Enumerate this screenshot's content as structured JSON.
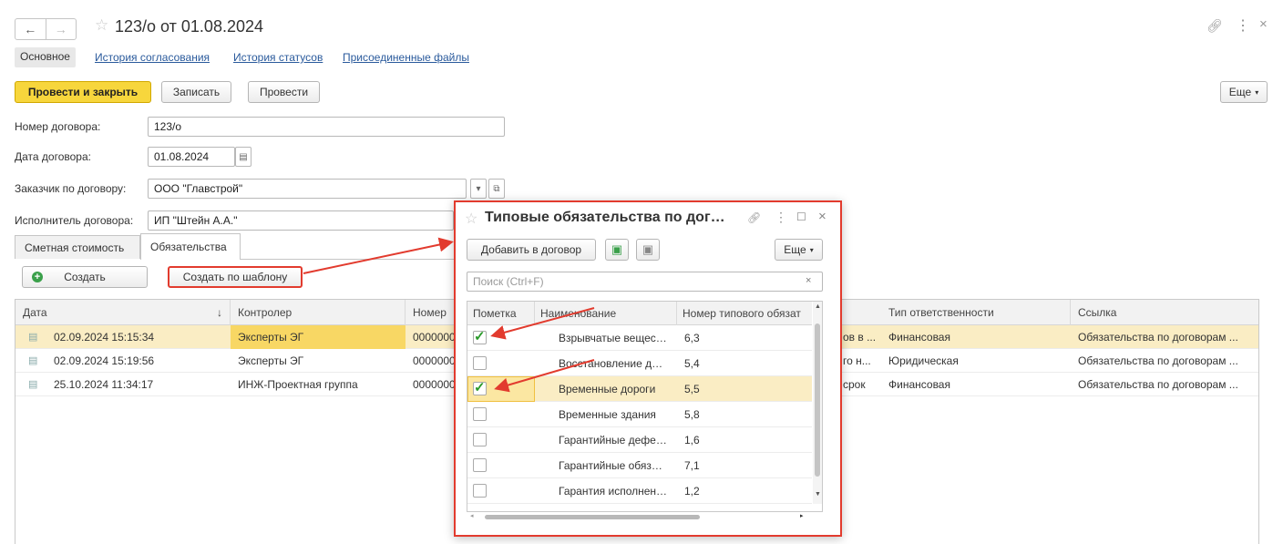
{
  "window": {
    "title": "123/о от 01.08.2024"
  },
  "tabs": [
    {
      "label": "Основное"
    },
    {
      "label": "История согласования"
    },
    {
      "label": "История статусов"
    },
    {
      "label": "Присоединенные файлы"
    }
  ],
  "toolbar": {
    "post_close": "Провести и закрыть",
    "save": "Записать",
    "post": "Провести",
    "more": "Еще"
  },
  "form": {
    "contract_number_label": "Номер договора:",
    "contract_number": "123/о",
    "contract_date_label": "Дата договора:",
    "contract_date": "01.08.2024",
    "customer_label": "Заказчик по договору:",
    "customer": "ООО \"Главстрой\"",
    "contractor_label": "Исполнитель договора:",
    "contractor": "ИП \"Штейн А.А.\""
  },
  "subtabs": [
    {
      "label": "Сметная стоимость"
    },
    {
      "label": "Обязательства"
    }
  ],
  "sub_toolbar": {
    "create": "Создать",
    "create_template": "Создать по шаблону"
  },
  "table": {
    "headers": [
      "Дата",
      "Контролер",
      "Номер",
      "Тип ответственности",
      "Ссылка"
    ],
    "rows": [
      {
        "date": "02.09.2024 15:15:34",
        "controller": "Эксперты ЭГ",
        "number": "0000000",
        "desc": "ов в ...",
        "resp": "Финансовая",
        "link": "Обязательства по договорам ..."
      },
      {
        "date": "02.09.2024 15:19:56",
        "controller": "Эксперты ЭГ",
        "number": "0000000",
        "desc": "го н...",
        "resp": "Юридическая",
        "link": "Обязательства по договорам ..."
      },
      {
        "date": "25.10.2024 11:34:17",
        "controller": "ИНЖ-Проектная группа",
        "number": "0000000",
        "desc": "срок",
        "resp": "Финансовая",
        "link": "Обязательства по договорам ..."
      }
    ]
  },
  "modal": {
    "title": "Типовые обязательства по дог…",
    "add_button": "Добавить в договор",
    "more": "Еще",
    "search_placeholder": "Поиск (Ctrl+F)",
    "headers": [
      "Пометка",
      "Наименование",
      "Номер типового обязат"
    ],
    "rows": [
      {
        "checked": true,
        "name": "Взрывчатые вещес…",
        "num": "6,3"
      },
      {
        "checked": false,
        "name": "Восстановление д…",
        "num": "5,4"
      },
      {
        "checked": true,
        "name": "Временные дороги",
        "num": "5,5"
      },
      {
        "checked": false,
        "name": "Временные здания",
        "num": "5,8"
      },
      {
        "checked": false,
        "name": "Гарантийные дефе…",
        "num": "1,6"
      },
      {
        "checked": false,
        "name": "Гарантийные обяз…",
        "num": "7,1"
      },
      {
        "checked": false,
        "name": "Гарантия исполнен…",
        "num": "1,2"
      }
    ]
  },
  "colors": {
    "accent_yellow": "#f7d63c",
    "highlight_red": "#e23b2e",
    "selection": "#faedc4",
    "link": "#2a5a9c"
  }
}
